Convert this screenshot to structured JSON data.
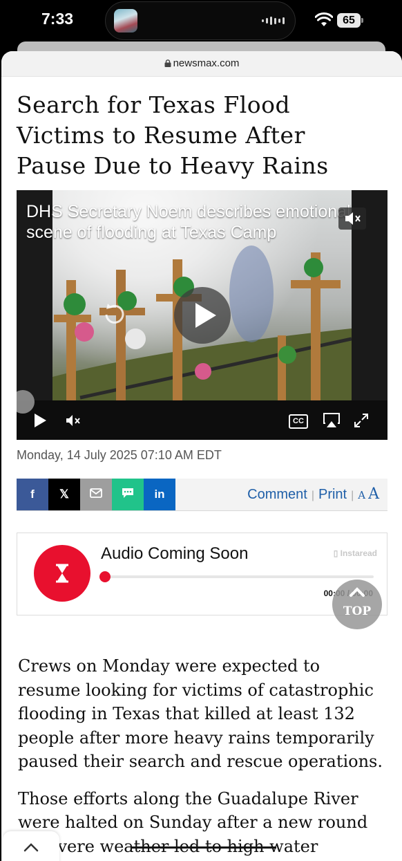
{
  "status_bar": {
    "time": "7:33",
    "battery": "65"
  },
  "browser": {
    "url": "newsmax.com"
  },
  "article": {
    "headline": "Search for Texas Flood Victims to Resume After Pause Due to Heavy Rains",
    "dateline": "Monday, 14 July 2025 07:10 AM EDT",
    "paragraphs": [
      "Crews on Monday were expected to resume looking for victims of catastrophic flooding in Texas that killed at least 132 people after more heavy rains temporarily paused their search and rescue operations.",
      "Those efforts along the Guadalupe River were halted on Sunday after a new round of severe weather led to high water rescues"
    ]
  },
  "video": {
    "title": "DHS Secretary Noem describes emotional scene of flooding at Texas Camp",
    "cc_label": "CC"
  },
  "share": {
    "buttons": [
      {
        "label": "f",
        "color": "#3b5998"
      },
      {
        "label": "𝕏",
        "color": "#000000"
      },
      {
        "label": "email",
        "color": "#9e9e9e"
      },
      {
        "label": "sms",
        "color": "#21c38a"
      },
      {
        "label": "in",
        "color": "#0a66c2"
      }
    ],
    "comment": "Comment",
    "print": "Print",
    "font_small": "A",
    "font_large": "A"
  },
  "audio": {
    "title": "Audio Coming Soon",
    "brand": "Instaread",
    "time": "00:00 / 00:00",
    "progress": 0
  },
  "top_button": {
    "label": "TOP"
  },
  "colors": {
    "accent_red": "#e8102e",
    "link_blue": "#1f5fa8"
  }
}
